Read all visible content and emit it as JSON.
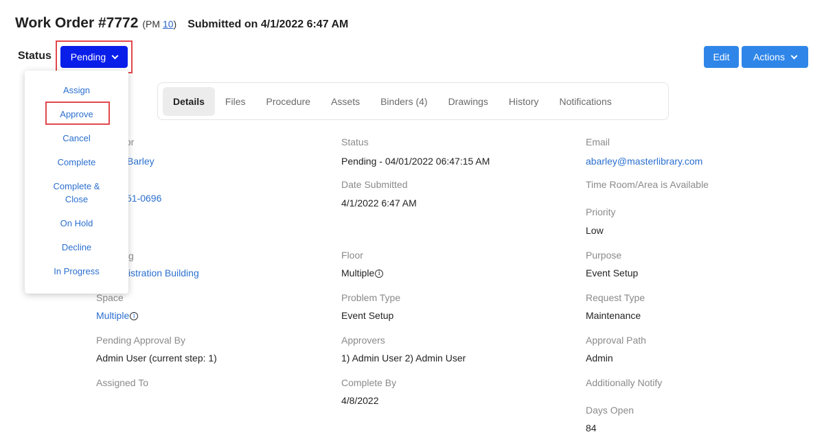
{
  "header": {
    "title": "Work Order #7772",
    "pm_prefix": "(PM",
    "pm_link": "10",
    "pm_suffix": ")",
    "submitted": "Submitted on 4/1/2022 6:47 AM"
  },
  "status": {
    "label": "Status",
    "button_label": "Pending",
    "menu": [
      "Assign",
      "Approve",
      "Cancel",
      "Complete",
      "Complete &",
      "Close",
      "On Hold",
      "Decline",
      "In Progress"
    ]
  },
  "toolbar": {
    "edit_label": "Edit",
    "actions_label": "Actions"
  },
  "tabs": [
    "Details",
    "Files",
    "Procedure",
    "Assets",
    "Binders (4)",
    "Drawings",
    "History",
    "Notifications"
  ],
  "fields": {
    "requestor_label_visible": "stor",
    "requestor_value_visible": "Barley",
    "phone_visible": "51-0696",
    "building_label_visible": "g",
    "building_value_visible": "istration Building",
    "space_label": "Space",
    "space_value": "Multiple",
    "pending_label": "Pending Approval By",
    "pending_value": "Admin User (current step: 1)",
    "assigned_label": "Assigned To",
    "status_label": "Status",
    "status_value": "Pending - 04/01/2022 06:47:15 AM",
    "date_label": "Date Submitted",
    "date_value": "4/1/2022 6:47 AM",
    "floor_label": "Floor",
    "floor_value": "Multiple",
    "problem_label": "Problem Type",
    "problem_value": "Event Setup",
    "approvers_label": "Approvers",
    "approvers_value": "1) Admin User 2) Admin User",
    "complete_label": "Complete By",
    "complete_value": "4/8/2022",
    "email_label": "Email",
    "email_value": "abarley@masterlibrary.com",
    "time_label": "Time Room/Area is Available",
    "priority_label": "Priority",
    "priority_value": "Low",
    "purpose_label": "Purpose",
    "purpose_value": "Event Setup",
    "request_label": "Request Type",
    "request_value": "Maintenance",
    "path_label": "Approval Path",
    "path_value": "Admin",
    "notify_label": "Additionally Notify",
    "days_label": "Days Open",
    "days_value": "84"
  },
  "icons": {
    "info": "info-circle-icon",
    "chevron": "chevron-down-icon"
  },
  "colors": {
    "primary": "#0a1eea",
    "button": "#2f86e8",
    "link": "#2a6fcf",
    "highlight": "#e0474c"
  }
}
